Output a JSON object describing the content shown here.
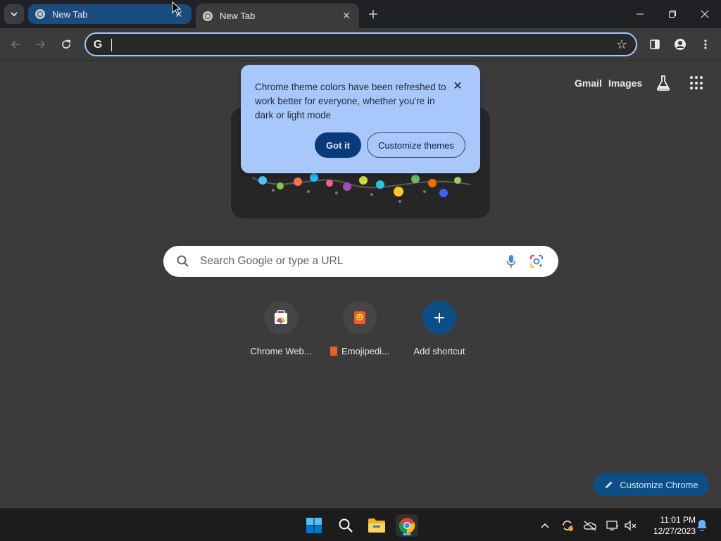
{
  "tabs": [
    {
      "title": "New Tab",
      "active": false
    },
    {
      "title": "New Tab",
      "active": true
    }
  ],
  "omnibox": {
    "value": ""
  },
  "toplinks": {
    "gmail": "Gmail",
    "images": "Images"
  },
  "bubble": {
    "message": "Chrome theme colors have been refreshed to work better for everyone, whether you're in dark or light mode",
    "got_it": "Got it",
    "customize_themes": "Customize themes"
  },
  "search": {
    "placeholder": "Search Google or type a URL"
  },
  "shortcuts": [
    {
      "label": "Chrome Web...",
      "icon": "chrome-web-store-icon"
    },
    {
      "label": "Emojipedi...",
      "icon": "emojipedia-icon"
    },
    {
      "label": "Add shortcut",
      "icon": "plus-icon"
    }
  ],
  "customize_chrome": {
    "label": "Customize Chrome"
  },
  "taskbar": {
    "time": "11:01 PM",
    "date": "12/27/2023"
  },
  "colors": {
    "accent": "#a8c7fa",
    "active_tab": "#1b4c80",
    "customize_button": "#0b4f86"
  }
}
